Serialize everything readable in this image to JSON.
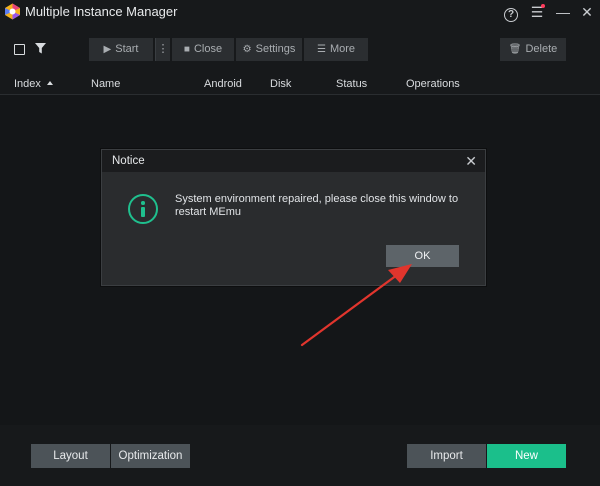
{
  "window": {
    "title": "Multiple Instance Manager",
    "controls": {
      "help": "?",
      "menu": "☰",
      "minimize": "—",
      "close": "✕"
    }
  },
  "toolbar": {
    "start_label": "Start",
    "close_label": "Close",
    "settings_label": "Settings",
    "more_label": "More",
    "delete_label": "Delete",
    "more_sep": "⋮"
  },
  "table": {
    "columns": [
      "Index",
      "Name",
      "Android",
      "Disk",
      "Status",
      "Operations"
    ],
    "sort_column": "Index",
    "sort_direction": "ascending"
  },
  "dialog": {
    "title": "Notice",
    "message": "System environment repaired, please close this window to restart MEmu",
    "ok_label": "OK",
    "close_glyph": "✕",
    "icon": "info-icon"
  },
  "footer": {
    "layout_label": "Layout",
    "optimization_label": "Optimization",
    "import_label": "Import",
    "new_label": "New"
  },
  "colors": {
    "background": "#141618",
    "accent_green": "#1bbf8b",
    "annotation_arrow": "#e1352d",
    "notification_dot": "#ff3b5c"
  }
}
